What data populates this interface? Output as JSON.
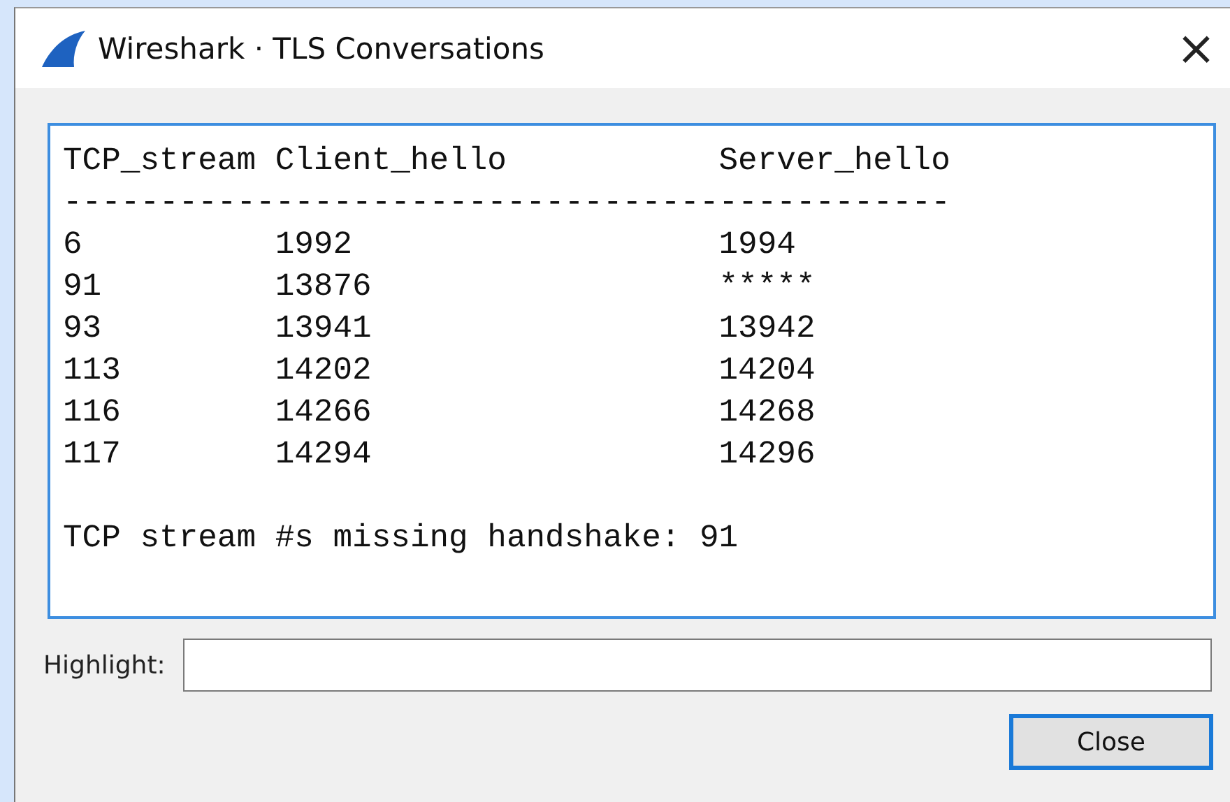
{
  "window": {
    "title": "Wireshark · TLS Conversations",
    "close_glyph": "×"
  },
  "output": {
    "columns": [
      "TCP_stream",
      "Client_hello",
      "Server_hello"
    ],
    "separator": "----------------------------------------------",
    "rows": [
      [
        "6",
        "1992",
        "1994"
      ],
      [
        "91",
        "13876",
        "*****"
      ],
      [
        "93",
        "13941",
        "13942"
      ],
      [
        "113",
        "14202",
        "14204"
      ],
      [
        "116",
        "14266",
        "14268"
      ],
      [
        "117",
        "14294",
        "14296"
      ]
    ],
    "summary": "TCP stream #s missing handshake: 91"
  },
  "highlight": {
    "label": "Highlight:"
  },
  "buttons": [
    {
      "label": "Close",
      "default": true
    }
  ]
}
